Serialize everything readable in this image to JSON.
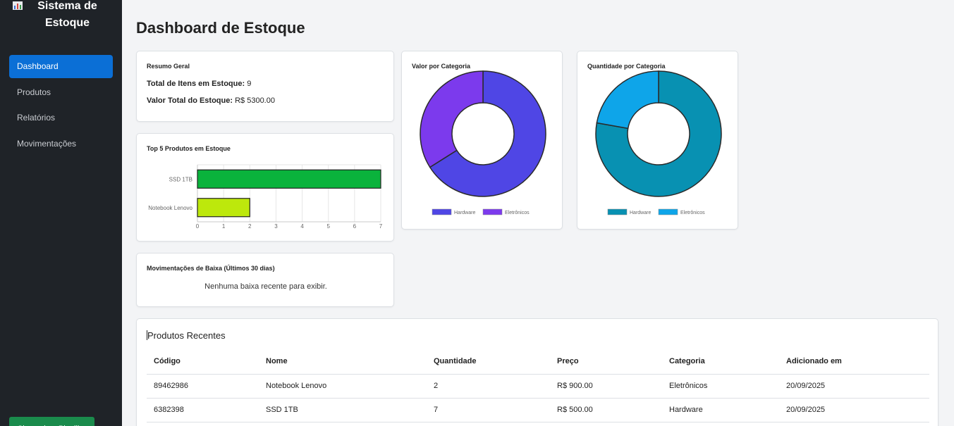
{
  "sidebar": {
    "brand": "Sistema de Estoque",
    "brand_icon": "bar-chart-icon",
    "items": [
      {
        "label": "Dashboard",
        "active": true
      },
      {
        "label": "Produtos",
        "active": false
      },
      {
        "label": "Relatórios",
        "active": false
      },
      {
        "label": "Movimentações",
        "active": false
      }
    ],
    "sync_button": "Sincronizar Planilha"
  },
  "page": {
    "title": "Dashboard de Estoque"
  },
  "resumo": {
    "title": "Resumo Geral",
    "total_itens_label": "Total de Itens em Estoque:",
    "total_itens_value": "9",
    "valor_total_label": "Valor Total do Estoque:",
    "valor_total_value": "R$ 5300.00"
  },
  "baixas": {
    "title": "Movimentações de Baixa (Últimos 30 dias)",
    "empty_message": "Nenhuma baixa recente para exibir."
  },
  "recentes": {
    "title": "Produtos Recentes",
    "columns": [
      "Código",
      "Nome",
      "Quantidade",
      "Preço",
      "Categoria",
      "Adicionado em"
    ],
    "rows": [
      [
        "89462986",
        "Notebook Lenovo",
        "2",
        "R$ 900.00",
        "Eletrônicos",
        "20/09/2025"
      ],
      [
        "6382398",
        "SSD 1TB",
        "7",
        "R$ 500.00",
        "Hardware",
        "20/09/2025"
      ]
    ]
  },
  "chart_data": [
    {
      "type": "bar",
      "orientation": "horizontal",
      "title": "Top 5 Produtos em Estoque",
      "categories": [
        "SSD 1TB",
        "Notebook Lenovo"
      ],
      "values": [
        7,
        2
      ],
      "colors": [
        "#0ab33c",
        "#bde80c"
      ],
      "xlim": [
        0,
        7
      ],
      "xticks": [
        "0",
        "1",
        "2",
        "3",
        "4",
        "5",
        "6",
        "7"
      ],
      "grid": true
    },
    {
      "type": "pie",
      "donut": true,
      "title": "Valor por Categoria",
      "labels": [
        "Hardware",
        "Eletrônicos"
      ],
      "values": [
        3500,
        1800
      ],
      "colors": [
        "#4f46e5",
        "#7c3aed"
      ],
      "legend": "bottom"
    },
    {
      "type": "pie",
      "donut": true,
      "title": "Quantidade por Categoria",
      "labels": [
        "Hardware",
        "Eletrônicos"
      ],
      "values": [
        7,
        2
      ],
      "colors": [
        "#0891b2",
        "#0ea5e9"
      ],
      "legend": "bottom"
    }
  ]
}
